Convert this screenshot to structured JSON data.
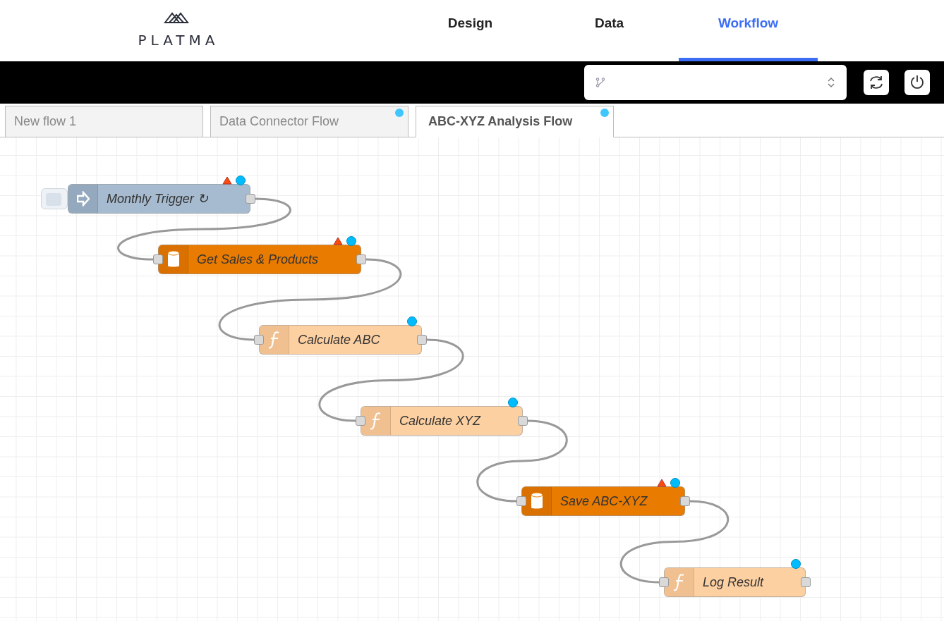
{
  "header": {
    "logo": "PLATMA",
    "nav": [
      {
        "label": "Design",
        "selected": false
      },
      {
        "label": "Data",
        "selected": false
      },
      {
        "label": "Workflow",
        "selected": true
      }
    ]
  },
  "flow_tabs": [
    {
      "label": "New flow 1",
      "selected": false,
      "changed": false
    },
    {
      "label": "Data Connector Flow",
      "selected": false,
      "changed": true
    },
    {
      "label": "ABC-XYZ Analysis Flow",
      "selected": true,
      "changed": true
    }
  ],
  "nodes": [
    {
      "label": "Monthly Trigger ↻",
      "kind": "inject",
      "warning": true,
      "changed": true
    },
    {
      "label": "Get Sales & Products",
      "kind": "database",
      "warning": true,
      "changed": true
    },
    {
      "label": "Calculate ABC",
      "kind": "function",
      "warning": false,
      "changed": true
    },
    {
      "label": "Calculate XYZ",
      "kind": "function",
      "warning": false,
      "changed": true
    },
    {
      "label": "Save ABC-XYZ",
      "kind": "database",
      "warning": true,
      "changed": true
    },
    {
      "label": "Log Result",
      "kind": "function",
      "warning": false,
      "changed": true
    }
  ]
}
